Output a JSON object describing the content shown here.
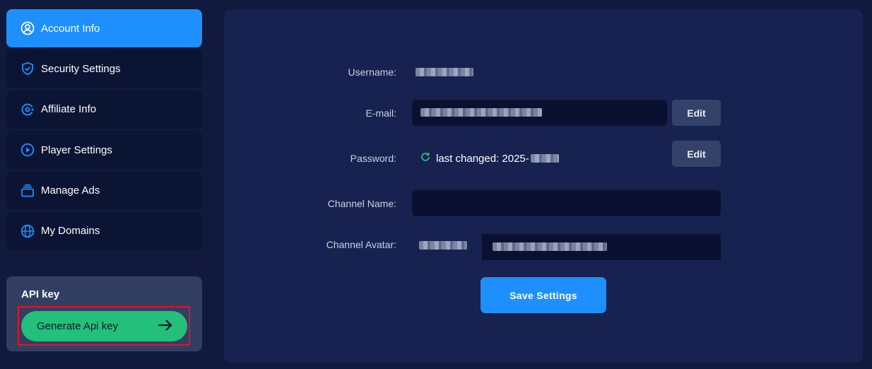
{
  "sidebar": {
    "items": [
      {
        "label": "Account Info",
        "icon": "user-circle-icon",
        "active": true
      },
      {
        "label": "Security Settings",
        "icon": "shield-icon"
      },
      {
        "label": "Affiliate Info",
        "icon": "affiliate-icon"
      },
      {
        "label": "Player Settings",
        "icon": "play-icon"
      },
      {
        "label": "Manage Ads",
        "icon": "stack-icon"
      },
      {
        "label": "My Domains",
        "icon": "globe-icon"
      }
    ]
  },
  "api": {
    "title": "API key",
    "button_label": "Generate Api key",
    "button_icon": "arrow-right-icon"
  },
  "form": {
    "username_label": "Username:",
    "email_label": "E-mail:",
    "email_edit": "Edit",
    "password_label": "Password:",
    "password_status": "last changed: 2025-",
    "password_edit": "Edit",
    "channel_name_label": "Channel Name:",
    "channel_name_value": "",
    "channel_avatar_label": "Channel Avatar:",
    "save_label": "Save Settings"
  },
  "colors": {
    "accent": "#1e8fff",
    "success": "#22c07a",
    "highlight": "#e5141e"
  }
}
